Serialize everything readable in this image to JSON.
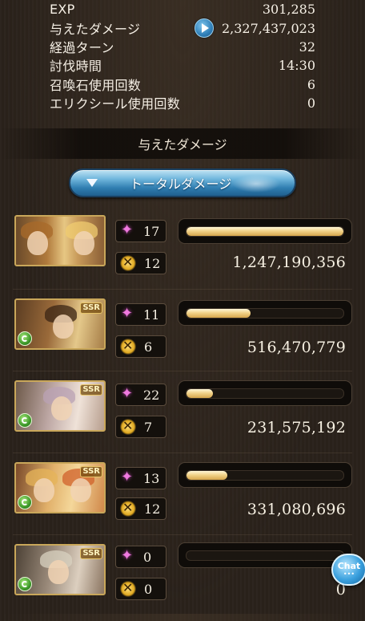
{
  "stats": [
    {
      "label": "EXP",
      "value": "301,285"
    },
    {
      "label": "与えたダメージ",
      "value": "2,327,437,023",
      "has_button": true
    },
    {
      "label": "経過ターン",
      "value": "32"
    },
    {
      "label": "討伐時間",
      "value": "14:30"
    },
    {
      "label": "召喚石使用回数",
      "value": "6"
    },
    {
      "label": "エリクシール使用回数",
      "value": "0"
    }
  ],
  "section_title": "与えたダメージ",
  "total_button_label": "トータルダメージ",
  "members": [
    {
      "portrait": "duo",
      "skill_count": "17",
      "attack_count": "12",
      "damage": "1,247,190,356",
      "bar_fraction": 1.0,
      "rarity": "",
      "element": ""
    },
    {
      "portrait": "dark",
      "skill_count": "11",
      "attack_count": "6",
      "damage": "516,470,779",
      "bar_fraction": 0.41,
      "rarity": "SSR",
      "element": "wind"
    },
    {
      "portrait": "silver",
      "skill_count": "22",
      "attack_count": "7",
      "damage": "231,575,192",
      "bar_fraction": 0.17,
      "rarity": "SSR",
      "element": "wind"
    },
    {
      "portrait": "twins",
      "skill_count": "13",
      "attack_count": "12",
      "damage": "331,080,696",
      "bar_fraction": 0.26,
      "rarity": "SSR",
      "element": "wind"
    },
    {
      "portrait": "elf",
      "skill_count": "0",
      "attack_count": "0",
      "damage": "0",
      "bar_fraction": 0.0,
      "rarity": "SSR",
      "element": "wind"
    }
  ],
  "chat": {
    "label": "Chat",
    "dots": "•••"
  },
  "colors": {
    "bar_fill": "#f2d38a",
    "skill_icon": "#f07ae0",
    "attack_icon": "#e0a820",
    "button_blue": "#2f7db0"
  },
  "icons": {
    "skill": "sparkle-icon",
    "attack": "swords-icon",
    "element": "wind-element-icon",
    "play": "play-icon"
  }
}
